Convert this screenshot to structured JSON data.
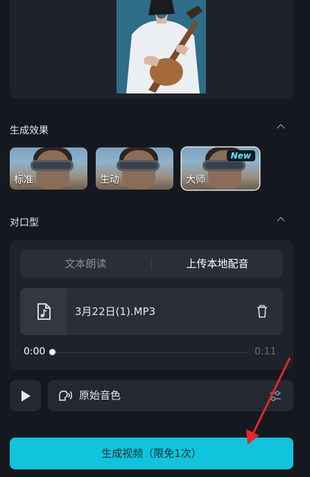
{
  "effects_section": {
    "title": "生成效果",
    "options": [
      {
        "label": "标准",
        "selected": false
      },
      {
        "label": "生动",
        "selected": false
      },
      {
        "label": "大师",
        "selected": true,
        "badge": "New"
      }
    ]
  },
  "lip_sync_section": {
    "title": "对口型",
    "tabs": [
      {
        "label": "文本朗读",
        "active": false
      },
      {
        "label": "上传本地配音",
        "active": true
      }
    ],
    "file": {
      "name": "3月22日(1).MP3"
    },
    "player": {
      "current_time": "0:00",
      "duration": "0:11",
      "progress": 0
    }
  },
  "voice": {
    "label": "原始音色"
  },
  "generate_button": {
    "label": "生成视频（限免1次）"
  },
  "colors": {
    "accent": "#11c3dc",
    "annotation_arrow": "#e8262b"
  },
  "icons": [
    "chevron-up-icon",
    "audio-file-icon",
    "trash-icon",
    "play-icon",
    "voice-icon",
    "sliders-icon"
  ]
}
